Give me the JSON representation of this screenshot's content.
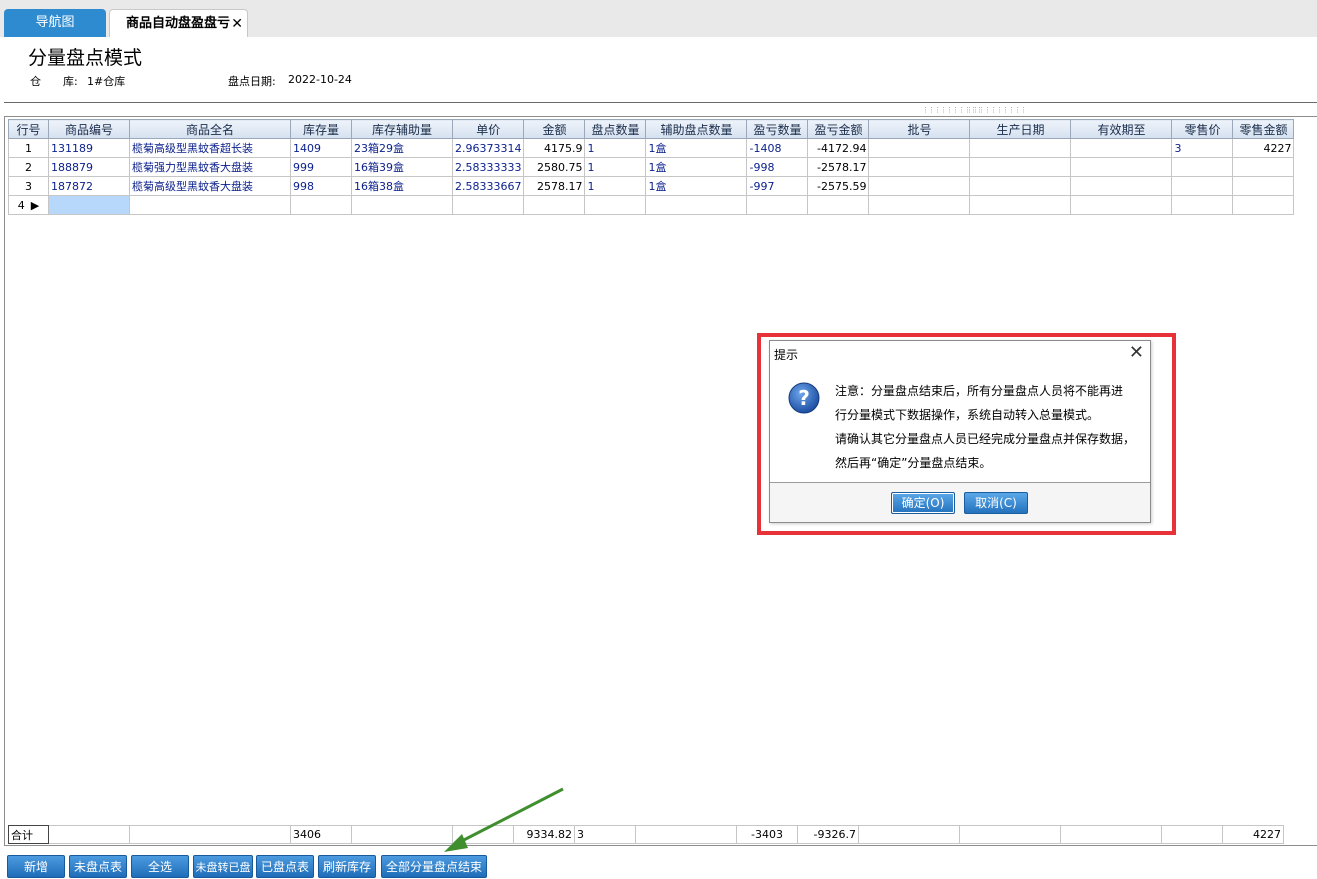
{
  "tabs": [
    {
      "label": "导航图"
    },
    {
      "label": "商品自动盘盈盘亏",
      "close": "✕"
    }
  ],
  "page": {
    "title": "分量盘点模式",
    "warehouse_label": "仓　　库:",
    "warehouse_value": "1#仓库",
    "date_label": "盘点日期:",
    "date_value": "2022-10-24"
  },
  "grid": {
    "columns": [
      "行号",
      "商品编号",
      "商品全名",
      "库存量",
      "库存辅助量",
      "单价",
      "金额",
      "盘点数量",
      "辅助盘点数量",
      "盈亏数量",
      "盈亏金额",
      "批号",
      "生产日期",
      "有效期至",
      "零售价",
      "零售金额"
    ],
    "rows": [
      [
        "1",
        "131189",
        "榄菊高级型黑蚊香超长装",
        "1409",
        "23箱29盒",
        "2.96373314",
        "4175.9",
        "1",
        "1盒",
        "-1408",
        "-4172.94",
        "",
        "",
        "",
        "3",
        "4227"
      ],
      [
        "2",
        "188879",
        "榄菊强力型黑蚊香大盘装",
        "999",
        "16箱39盒",
        "2.58333333",
        "2580.75",
        "1",
        "1盒",
        "-998",
        "-2578.17",
        "",
        "",
        "",
        "",
        ""
      ],
      [
        "3",
        "187872",
        "榄菊高级型黑蚊香大盘装",
        "998",
        "16箱38盒",
        "2.58333667",
        "2578.17",
        "1",
        "1盒",
        "-997",
        "-2575.59",
        "",
        "",
        "",
        "",
        ""
      ]
    ],
    "new_row_index": "4",
    "row_pointer": "▶",
    "totals": [
      "合计",
      "",
      "",
      "3406",
      "",
      "",
      "9334.82",
      "3",
      "",
      "-3403",
      "-9326.7",
      "",
      "",
      "",
      "",
      "4227"
    ]
  },
  "buttons": [
    "新增",
    "未盘点表",
    "全选",
    "未盘转已盘",
    "已盘点表",
    "刷新库存",
    "全部分量盘点结束"
  ],
  "dialog": {
    "title": "提示",
    "close": "✕",
    "icon": "question-icon",
    "lines": [
      "注意：分量盘点结束后，所有分量盘点人员将不能再进",
      "行分量模式下数据操作，系统自动转入总量模式。",
      "请确认其它分量盘点人员已经完成分量盘点并保存数据，",
      "然后再“确定”分量盘点结束。"
    ],
    "ok_label": "确定(O)",
    "cancel_label": "取消(C)"
  },
  "colors": {
    "tab_blue": "#2e8bd0",
    "highlight_red": "#e8323a",
    "arrow_green": "#3f8f2f",
    "button_blue": "#1f6db8"
  }
}
